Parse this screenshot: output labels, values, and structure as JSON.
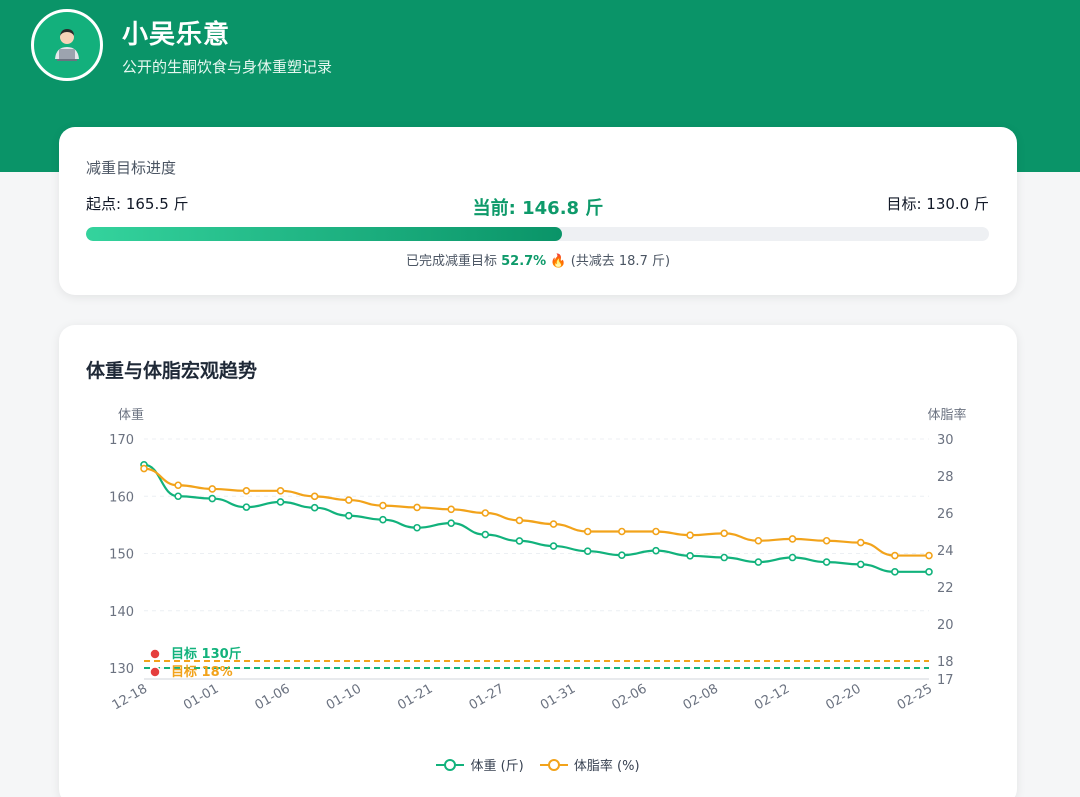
{
  "header": {
    "title": "小吴乐意",
    "subtitle": "公开的生酮饮食与身体重塑记录",
    "avatar_icon": "laptop-person-icon",
    "bg_color": "#0a9468"
  },
  "progress": {
    "title": "减重目标进度",
    "start_text": "起点: 165.5 斤",
    "current_text": "当前: 146.8 斤",
    "target_text": "目标: 130.0 斤",
    "percent_value": 52.7,
    "note_prefix": "已完成减重目标",
    "note_percent": "52.7%",
    "note_icon": "🔥",
    "note_suffix": "(共减去 18.7 斤)"
  },
  "chart_section": {
    "title": "体重与体脂宏观趋势",
    "legend": [
      {
        "name": "体重 (斤)",
        "color": "#12b27c"
      },
      {
        "name": "体脂率 (%)",
        "color": "#f2a31b"
      }
    ]
  },
  "chart_data": {
    "type": "line",
    "ylabel_left": "体重",
    "ylabel_right": "体脂率",
    "ylim_left": [
      130,
      170
    ],
    "yticks_left": [
      130,
      140,
      150,
      160,
      170
    ],
    "ylim_right": [
      17,
      30
    ],
    "yticks_right": [
      17,
      18,
      20,
      22,
      24,
      26,
      28,
      30
    ],
    "xtick_labels": [
      "12-18",
      "01-01",
      "01-06",
      "01-10",
      "01-21",
      "01-27",
      "01-31",
      "02-06",
      "02-08",
      "02-12",
      "02-20",
      "02-25"
    ],
    "grid": true,
    "legend_position": "bottom",
    "series": [
      {
        "name": "体重 (斤)",
        "axis": "left",
        "color": "#12b27c",
        "values": [
          165.5,
          160.0,
          159.6,
          158.1,
          159.0,
          158.0,
          156.6,
          155.9,
          154.5,
          155.3,
          153.3,
          152.2,
          151.3,
          150.4,
          149.7,
          150.5,
          149.6,
          149.3,
          148.5,
          149.3,
          148.5,
          148.1,
          146.8,
          146.8
        ]
      },
      {
        "name": "体脂率 (%)",
        "axis": "right",
        "color": "#f2a31b",
        "values": [
          28.4,
          27.5,
          27.3,
          27.2,
          27.2,
          26.9,
          26.7,
          26.4,
          26.3,
          26.2,
          26.0,
          25.6,
          25.4,
          25.0,
          25.0,
          25.0,
          24.8,
          24.9,
          24.5,
          24.6,
          24.5,
          24.4,
          23.7,
          23.7
        ]
      }
    ],
    "reference_lines": [
      {
        "label": "目标 130斤",
        "axis": "left",
        "value": 130,
        "color": "#12b27c",
        "icon": "target-icon"
      },
      {
        "label": "目标 18%",
        "axis": "right",
        "value": 18,
        "color": "#f2a31b",
        "icon": "target-icon"
      }
    ]
  }
}
